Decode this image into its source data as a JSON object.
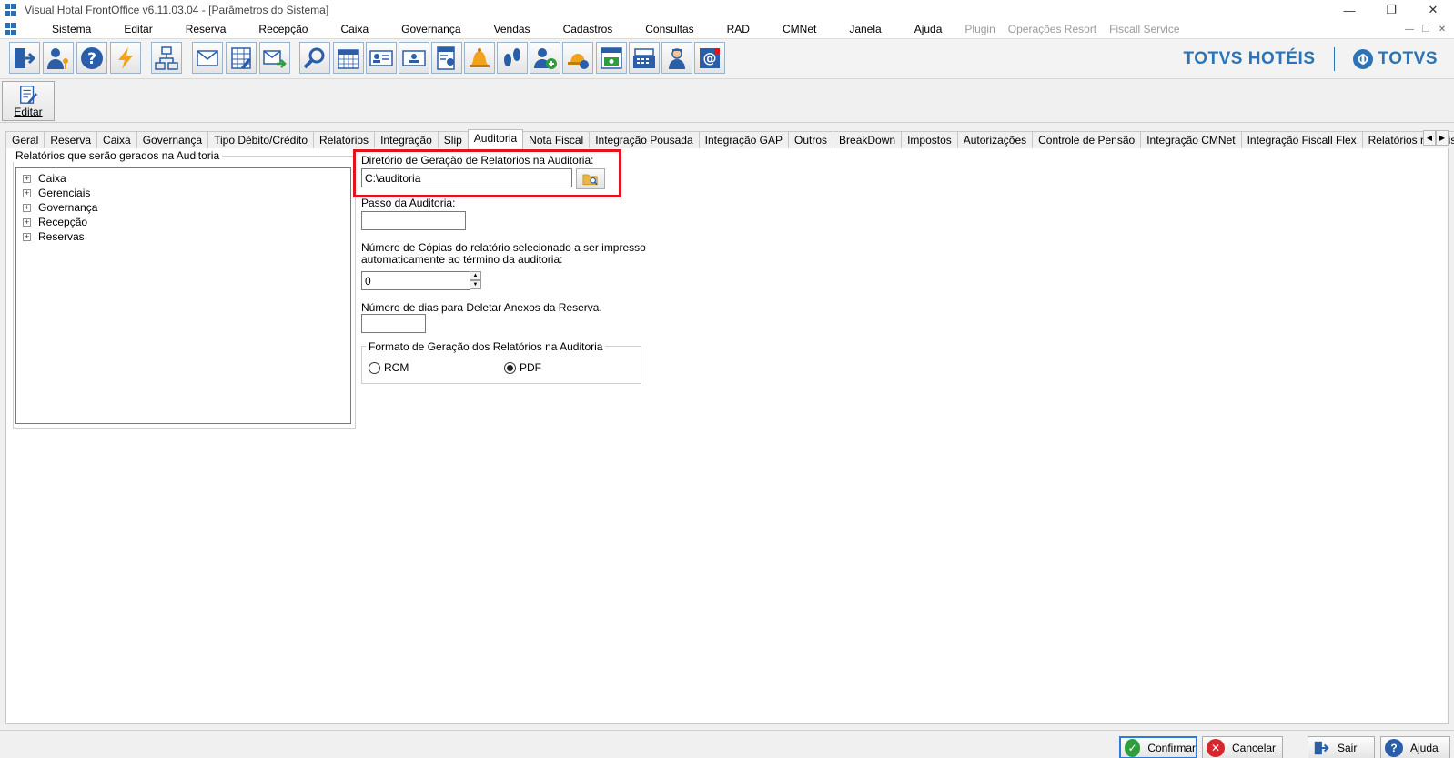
{
  "window": {
    "title": "Visual Hotal FrontOffice v6.11.03.04 - [Parâmetros do Sistema]"
  },
  "menu": {
    "items": [
      "Sistema",
      "Editar",
      "Reserva",
      "Recepção",
      "Caixa",
      "Governança",
      "Vendas",
      "Cadastros",
      "Consultas",
      "RAD",
      "CMNet",
      "Janela",
      "Ajuda"
    ],
    "disabled": [
      "Plugin",
      "Operações Resort",
      "Fiscall Service"
    ]
  },
  "toolbar": {
    "icons": [
      "exit-icon",
      "user-key-icon",
      "help-icon",
      "lightning-icon",
      "network-icon",
      "mail-icon",
      "calculator-icon",
      "mail-send-icon",
      "search-icon",
      "calendar-icon",
      "id-card-icon",
      "id-card-alt-icon",
      "report-user-icon",
      "bell-icon",
      "footprints-icon",
      "add-user-icon",
      "reception-icon",
      "money-icon",
      "cash-register-icon",
      "maid-icon",
      "email-at-icon"
    ]
  },
  "brand": {
    "primary": "TOTVS HOTÉIS",
    "secondary": "TOTVS",
    "color": "#2c74b5"
  },
  "edit_button": {
    "label": "Editar"
  },
  "tabs": {
    "items": [
      "Geral",
      "Reserva",
      "Caixa",
      "Governança",
      "Tipo Débito/Crédito",
      "Relatórios",
      "Integração",
      "Slip",
      "Auditoria",
      "Nota Fiscal",
      "Integração Pousada",
      "Integração GAP",
      "Outros",
      "BreakDown",
      "Impostos",
      "Autorizações",
      "Controle de Pensão",
      "Integração CMNet",
      "Integração Fiscall Flex",
      "Relatórios não Fisca"
    ],
    "active": "Auditoria"
  },
  "reports_tree": {
    "title": "Relatórios que serão gerados na Auditoria",
    "items": [
      "Caixa",
      "Gerenciais",
      "Governança",
      "Recepção",
      "Reservas"
    ]
  },
  "form": {
    "directory_label": "Diretório de Geração de Relatórios na Auditoria:",
    "directory_value": "C:\\auditoria",
    "step_label": "Passo da Auditoria:",
    "step_value": "",
    "copies_label_1": "Número de Cópias do relatório selecionado a ser impresso",
    "copies_label_2": "automaticamente ao término da auditoria:",
    "copies_value": "0",
    "days_label": "Número de dias para Deletar Anexos da Reserva.",
    "days_value": "",
    "format_title": "Formato de Geração dos Relatórios na Auditoria",
    "format_options": [
      "RCM",
      "PDF"
    ],
    "format_selected": "PDF"
  },
  "footer": {
    "confirm": "Confirmar",
    "cancel": "Cancelar",
    "exit": "Sair",
    "help": "Ajuda"
  },
  "colors": {
    "highlight": "#e3121e",
    "accent": "#2b7bd8"
  }
}
